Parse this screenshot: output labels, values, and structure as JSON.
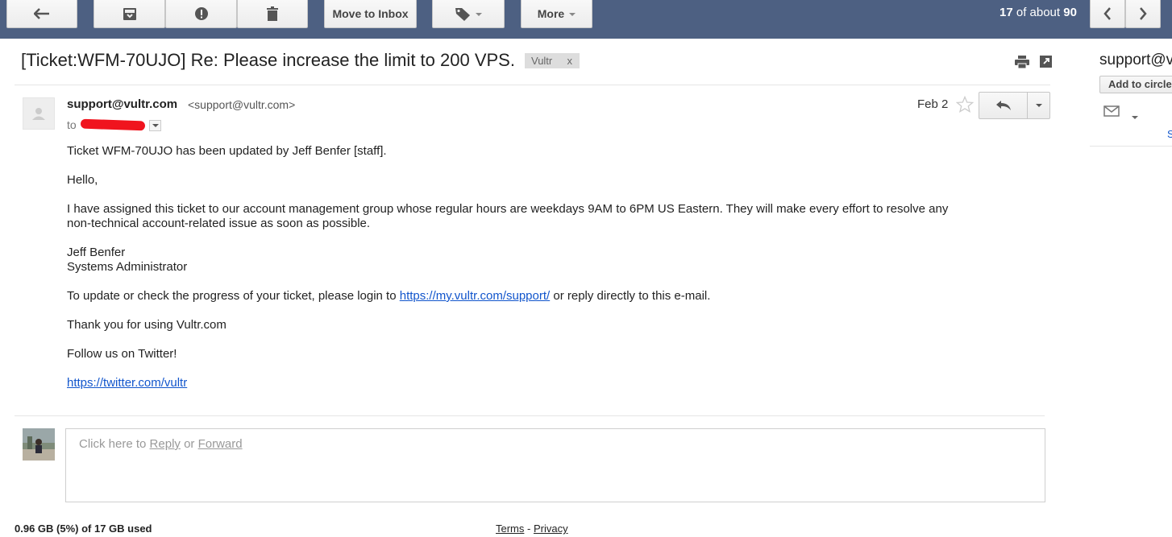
{
  "toolbar": {
    "back_icon": "arrow-back-icon",
    "archive_icon": "archive-icon",
    "spam_icon": "report-spam-icon",
    "delete_icon": "trash-icon",
    "move_to_inbox_label": "Move to Inbox",
    "labels_icon": "tag-icon",
    "more_label": "More",
    "pager_current": "17",
    "pager_of": " of about ",
    "pager_total": "90",
    "prev_icon": "chevron-left-icon",
    "next_icon": "chevron-right-icon",
    "bar_color": "#4d6082"
  },
  "message": {
    "subject": "[Ticket:WFM-70UJO] Re: Please increase the limit to 200 VPS.",
    "label": "Vultr",
    "label_remove": "x",
    "sender_name": "support@vultr.com",
    "sender_email": "<support@vultr.com>",
    "to_prefix": "to",
    "date": "Feb 2",
    "body": {
      "line1": "Ticket WFM-70UJO has been updated by Jeff Benfer [staff].",
      "greeting": "Hello,",
      "para1_line1": "I have assigned this ticket to our account management group whose regular hours are weekdays 9AM to 6PM US Eastern. They will make every effort to resolve any",
      "para1_line2": "non-technical account-related issue as soon as possible.",
      "sig_name": "Jeff Benfer",
      "sig_title": "Systems Administrator",
      "update_prefix": "To update or check the progress of your ticket, please login to ",
      "update_link": "https://my.vultr.com/support/",
      "update_suffix": " or reply directly to this e-mail.",
      "thanks": "Thank you for using Vultr.com",
      "follow": "Follow us on Twitter!",
      "twitter_link": "https://twitter.com/vultr"
    }
  },
  "reply_box": {
    "prefix": "Click here to ",
    "reply": "Reply",
    "or": " or ",
    "forward": "Forward"
  },
  "footer": {
    "storage": "0.96 GB (5%) of 17 GB used",
    "terms": "Terms",
    "separator": " - ",
    "privacy": "Privacy"
  },
  "side_panel": {
    "name": "support@vultr.com",
    "add_to_circles": "Add to circles",
    "link_char": "S"
  }
}
